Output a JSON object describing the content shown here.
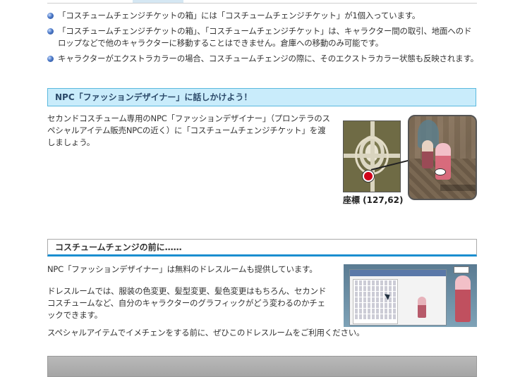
{
  "bullets": [
    "「コスチュームチェンジチケットの箱」には「コスチュームチェンジチケット」が1個入っています。",
    "「コスチュームチェンジチケットの箱」、「コスチュームチェンジチケット」は、キャラクター間の取引、地面へのドロップなどで他のキャラクターに移動することはできません。倉庫への移動のみ可能です。",
    "キャラクターがエクストラカラーの場合、コスチュームチェンジの際に、そのエクストラカラー状態も反映されます。"
  ],
  "section1": {
    "heading": "NPC「ファッションデザイナー」に話しかけよう！",
    "text": "セカンドコスチューム専用のNPC「ファッションデザイナー」（プロンテラのスペシャルアイテム販売NPCの近く）に「コスチュームチェンジチケット」を渡しましょう。",
    "coords": "座標 (127,62)"
  },
  "section2": {
    "heading": "コスチュームチェンジの前に……",
    "text1": "NPC「ファッションデザイナー」は無料のドレスルームも提供しています。",
    "text2": "ドレスルームでは、服装の色変更、髪型変更、髪色変更はもちろん、セカンドコスチュームなど、自分のキャラクターのグラフィックがどう変わるのかチェックできます。",
    "text3": "スペシャルアイテムでイメチェンをする前に、ぜひこのドレスルームをご利用ください。"
  },
  "colors": {
    "heading_bg": "#c9ecfb",
    "heading_border": "#5ab9de",
    "accent_underline": "#1a8ed0",
    "map_marker": "#d0021b"
  },
  "icons": {
    "bullet": "blue-dot-icon"
  }
}
